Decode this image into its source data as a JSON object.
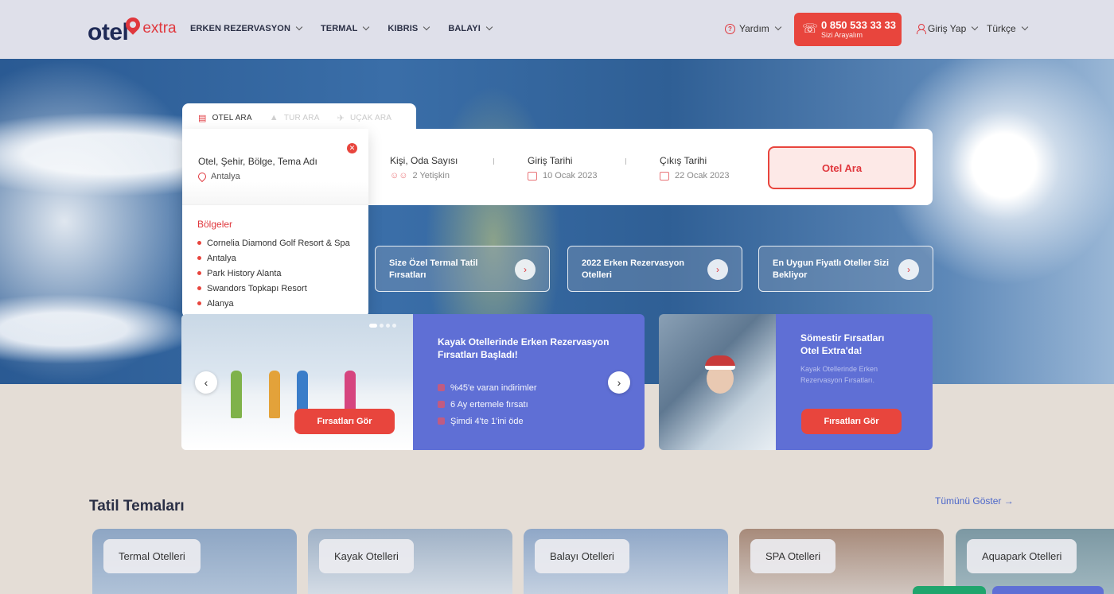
{
  "header": {
    "logo_main": "otel",
    "logo_accent": "extra",
    "nav": [
      "ERKEN REZERVASYON",
      "TERMAL",
      "KIBRIS",
      "BALAYI"
    ],
    "help": "Yardım",
    "phone_number": "0 850 533 33 33",
    "phone_sub": "Sizi Arayalım",
    "login": "Giriş Yap",
    "language": "Türkçe"
  },
  "search": {
    "tabs": [
      "OTEL ARA",
      "TUR ARA",
      "UÇAK ARA"
    ],
    "location_label": "Otel, Şehir, Bölge, Tema Adı",
    "location_value": "Antalya",
    "guests_label": "Kişi, Oda Sayısı",
    "guests_value": "2 Yetişkin",
    "checkin_label": "Giriş Tarihi",
    "checkin_value": "10 Ocak 2023",
    "checkout_label": "Çıkış Tarihi",
    "checkout_value": "22 Ocak 2023",
    "button": "Otel Ara",
    "dropdown_title": "Bölgeler",
    "dropdown_items": [
      "Cornelia Diamond Golf Resort & Spa",
      "Antalya",
      "Park History Alanta",
      "Swandors Topkapı Resort",
      "Alanya"
    ]
  },
  "promos": [
    "Size Özel Termal Tatil Fırsatları",
    "2022 Erken Rezervasyon Otelleri",
    "En Uygun Fiyatlı Oteller Sizi Bekliyor"
  ],
  "slider": {
    "title": "Kayak Otellerinde Erken Rezervasyon Fırsatları Başladı!",
    "bullets": [
      "%45'e varan indirimler",
      "6 Ay ertemele fırsatı",
      "Şimdi 4'te 1'ini öde"
    ],
    "button": "Fırsatları Gör"
  },
  "card2": {
    "title": "Sömestir Fırsatları Otel Extra'da!",
    "subtitle": "Kayak Otellerinde Erken Rezervasyon Fırsatları.",
    "button": "Fırsatları Gör"
  },
  "themes": {
    "title": "Tatil Temaları",
    "see_all": "Tümünü Göster",
    "items": [
      "Termal Otelleri",
      "Kayak Otelleri",
      "Balayı Otelleri",
      "SPA Otelleri",
      "Aquapark Otelleri"
    ]
  }
}
